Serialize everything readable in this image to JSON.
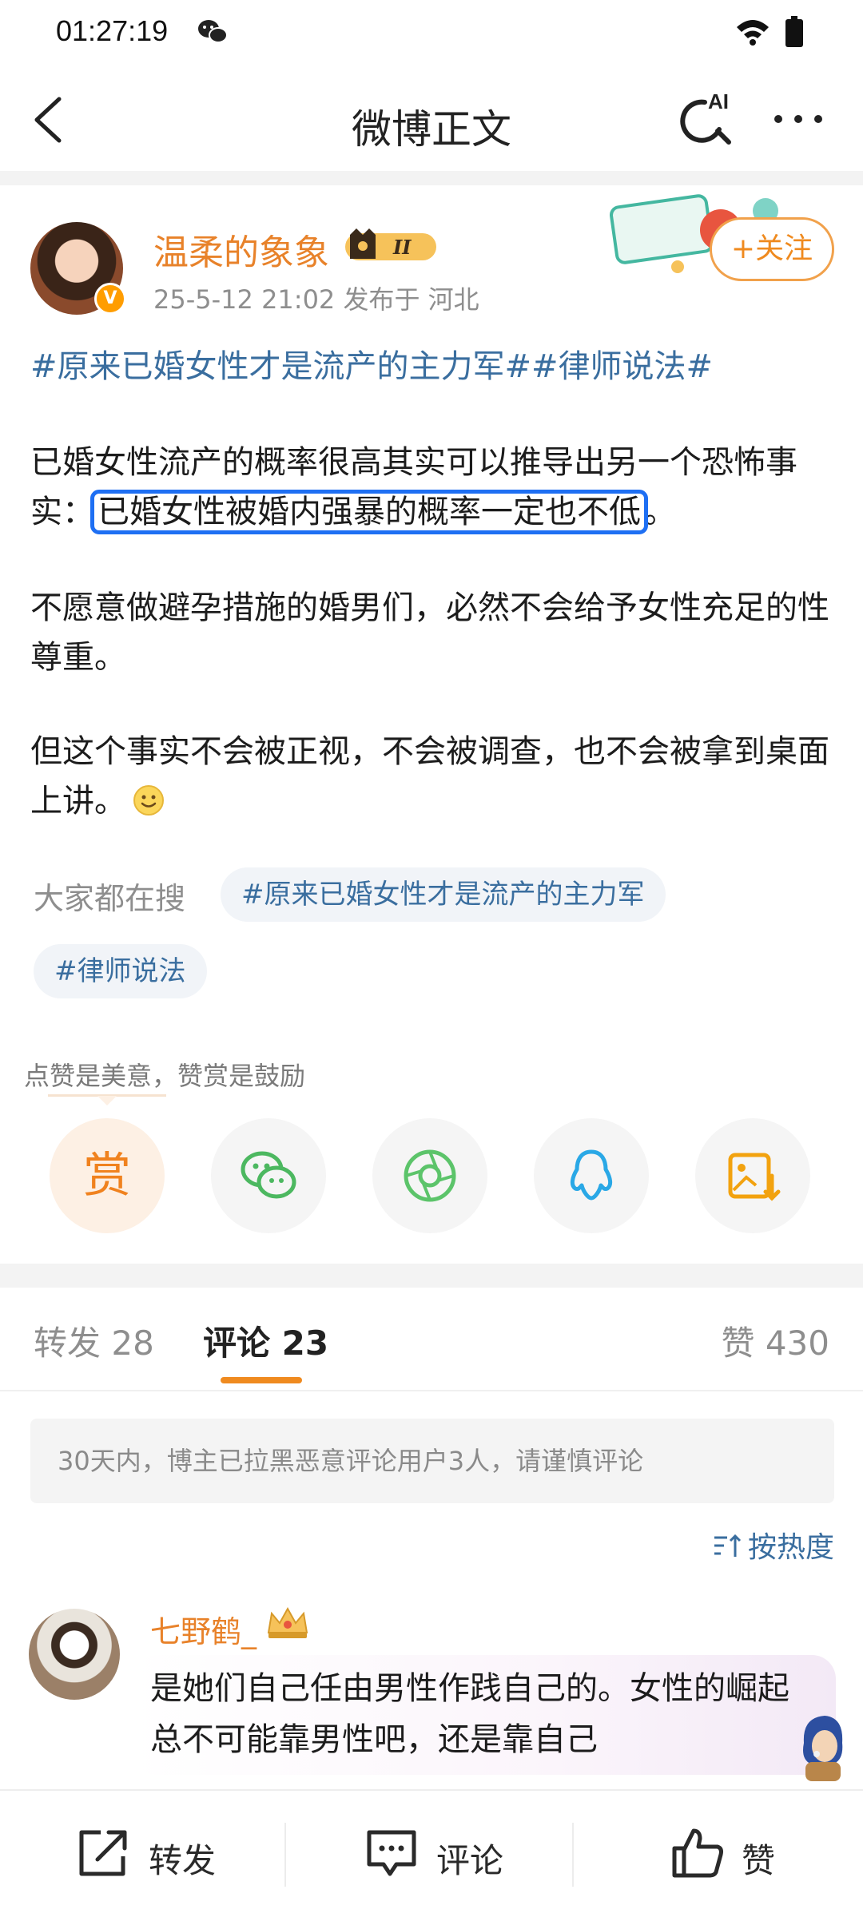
{
  "status_bar": {
    "time": "01:27:19"
  },
  "nav": {
    "title": "微博正文"
  },
  "post": {
    "username": "温柔的象象",
    "meta": "25-5-12 21:02  发布于 河北",
    "follow_label": "+关注",
    "hashtags": "#原来已婚女性才是流产的主力军##律师说法#",
    "paragraph1_start": "已婚女性流产的概率很高其实可以推导出另一个恐怖事实：",
    "paragraph1_highlight": "已婚女性被婚内强暴的概率一定也不低",
    "paragraph1_end": "。",
    "paragraph2": "不愿意做避孕措施的婚男们，必然不会给予女性充足的性尊重。",
    "paragraph3": "但这个事实不会被正视，不会被调查，也不会被拿到桌面上讲。"
  },
  "search": {
    "label": "大家都在搜",
    "tags": [
      "#原来已婚女性才是流产的主力军",
      "#律师说法"
    ]
  },
  "reward": {
    "hint": "点赞是美意，赞赏是鼓励",
    "reward_glyph": "赏",
    "share_icons": [
      "wechat-icon",
      "moments-icon",
      "qq-icon",
      "save-image-icon"
    ]
  },
  "tabs": {
    "repost": "转发 28",
    "comments": "评论 23",
    "likes": "赞 430"
  },
  "notice": "30天内，博主已拉黑恶意评论用户3人，请谨慎评论",
  "sort_label": "按热度",
  "comment": {
    "username": "七野鹤_",
    "text": "是她们自己任由男性作践自己的。女性的崛起总不可能靠男性吧，还是靠自己"
  },
  "bottom_bar": {
    "repost": "转发",
    "comment": "评论",
    "like": "赞"
  },
  "colors": {
    "accent_orange": "#ef8a1f",
    "link_blue": "#3a6e9f",
    "highlight_blue": "#1e6ff3"
  }
}
